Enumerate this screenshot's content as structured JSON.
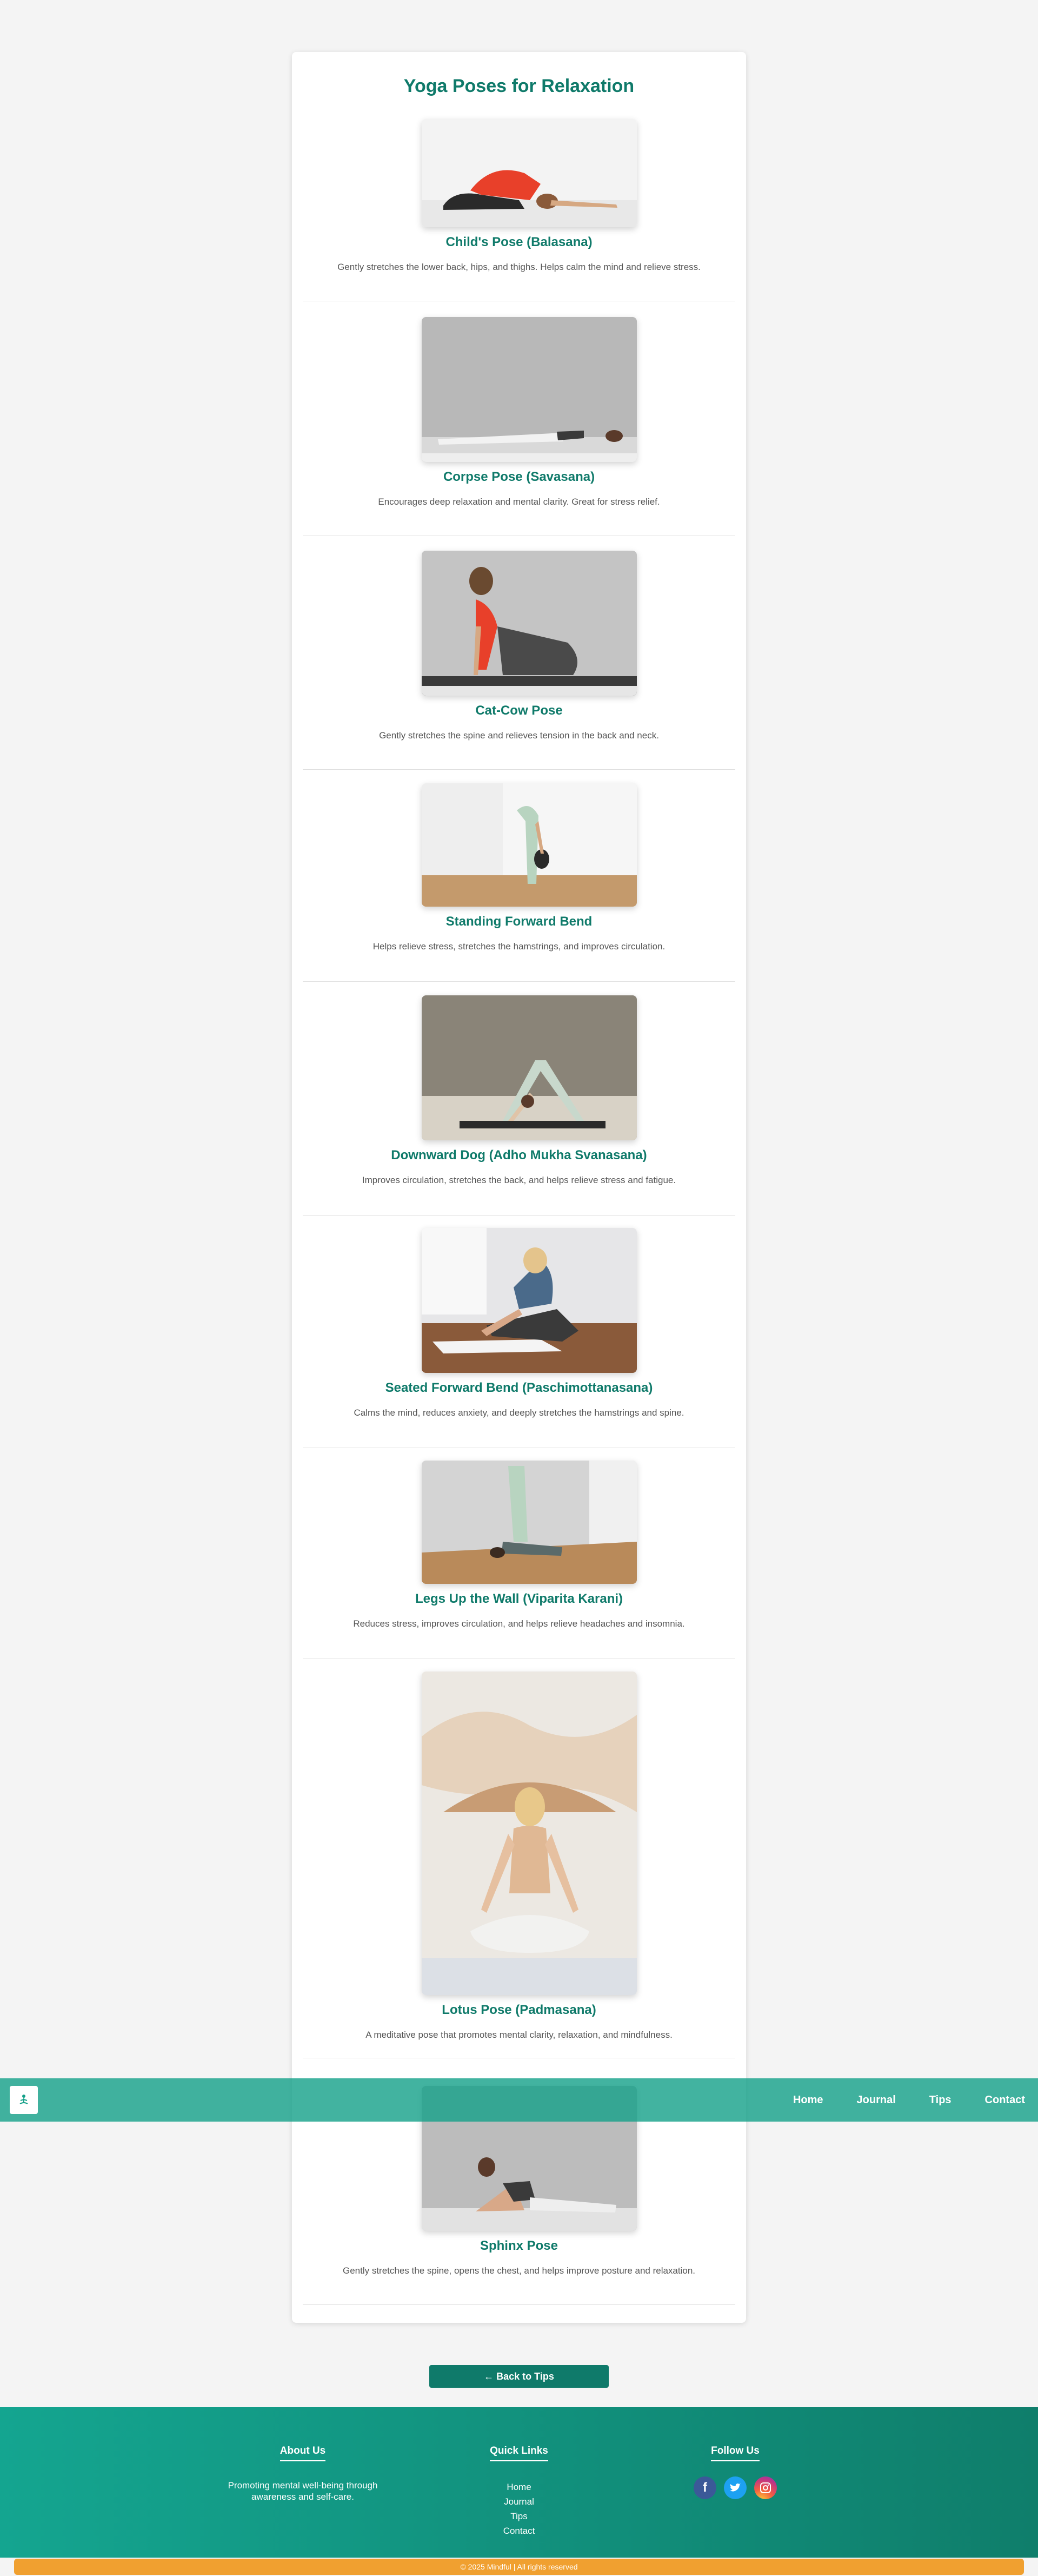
{
  "page_title": "Yoga Poses for Relaxation",
  "poses": [
    {
      "name": "Child's Pose (Balasana)",
      "desc": "Gently stretches the lower back, hips, and thighs. Helps calm the mind and relieve stress."
    },
    {
      "name": "Corpse Pose (Savasana)",
      "desc": "Encourages deep relaxation and mental clarity. Great for stress relief."
    },
    {
      "name": "Cat-Cow Pose",
      "desc": "Gently stretches the spine and relieves tension in the back and neck."
    },
    {
      "name": "Standing Forward Bend",
      "desc": "Helps relieve stress, stretches the hamstrings, and improves circulation."
    },
    {
      "name": "Downward Dog (Adho Mukha Svanasana)",
      "desc": "Improves circulation, stretches the back, and helps relieve stress and fatigue."
    },
    {
      "name": "Seated Forward Bend (Paschimottanasana)",
      "desc": "Calms the mind, reduces anxiety, and deeply stretches the hamstrings and spine."
    },
    {
      "name": "Legs Up the Wall (Viparita Karani)",
      "desc": "Reduces stress, improves circulation, and helps relieve headaches and insomnia."
    },
    {
      "name": "Lotus Pose (Padmasana)",
      "desc": "A meditative pose that promotes mental clarity, relaxation, and mindfulness."
    },
    {
      "name": "Sphinx Pose",
      "desc": "Gently stretches the spine, opens the chest, and helps improve posture and relaxation."
    }
  ],
  "nav": {
    "logo_icon": "meditation-logo-icon",
    "links": [
      "Home",
      "Journal",
      "Tips",
      "Contact"
    ]
  },
  "back_button": "← Back to Tips",
  "footer": {
    "about_title": "About Us",
    "about_text": "Promoting mental well-being through awareness and self-care.",
    "quick_title": "Quick Links",
    "quick_links": [
      "Home",
      "Journal",
      "Tips",
      "Contact"
    ],
    "follow_title": "Follow Us",
    "social_icons": [
      "facebook-icon",
      "twitter-icon",
      "instagram-icon"
    ]
  },
  "copyright": "© 2025 Mindful | All rights reserved",
  "colors": {
    "brand": "#0f7a6a",
    "navbar": "#13a088",
    "accent_orange": "#f0a030"
  }
}
